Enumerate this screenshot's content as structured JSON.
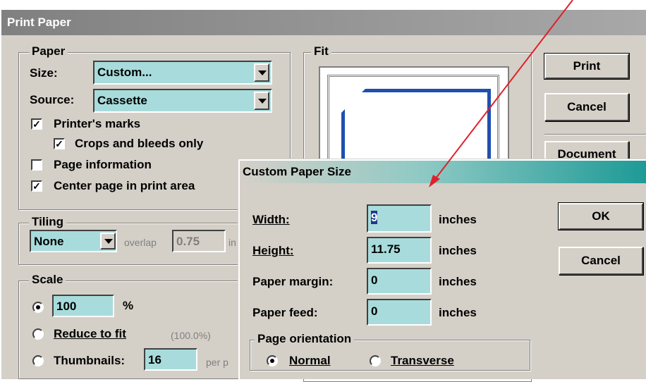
{
  "main_dialog": {
    "title": "Print Paper",
    "paper": {
      "legend": "Paper",
      "size_label": "Size:",
      "size_value": "Custom...",
      "source_label": "Source:",
      "source_value": "Cassette",
      "printers_marks": "Printer's marks",
      "crops_bleeds": "Crops and bleeds only",
      "page_information": "Page information",
      "center_page": "Center page in print area"
    },
    "fit": {
      "legend": "Fit"
    },
    "tiling": {
      "legend": "Tiling",
      "value": "None",
      "overlap_label": "overlap",
      "overlap_value": "0.75",
      "unit_partial": "in"
    },
    "scale": {
      "legend": "Scale",
      "percent_value": "100",
      "percent_sign": "%",
      "reduce_to_fit": "Reduce to fit",
      "reduce_value": "(100.0%)",
      "thumbnails": "Thumbnails:",
      "thumbnails_value": "16",
      "per_partial": "per p"
    },
    "buttons": {
      "print": "Print",
      "cancel": "Cancel",
      "document": "Document"
    }
  },
  "custom_dialog": {
    "title": "Custom Paper Size",
    "width_label": "Width:",
    "width_value": "9",
    "height_label": "Height:",
    "height_value": "11.75",
    "margin_label": "Paper margin:",
    "margin_value": "0",
    "feed_label": "Paper feed:",
    "feed_value": "0",
    "unit": "inches",
    "orientation": {
      "legend": "Page orientation",
      "normal": "Normal",
      "transverse": "Transverse",
      "selected": "Normal"
    },
    "ok": "OK",
    "cancel": "Cancel"
  },
  "colors": {
    "field_bg": "#a8dcdc",
    "dialog_bg": "#d4d0c8",
    "arrow": "#e0202c",
    "preview_border": "#1f4fb0"
  }
}
